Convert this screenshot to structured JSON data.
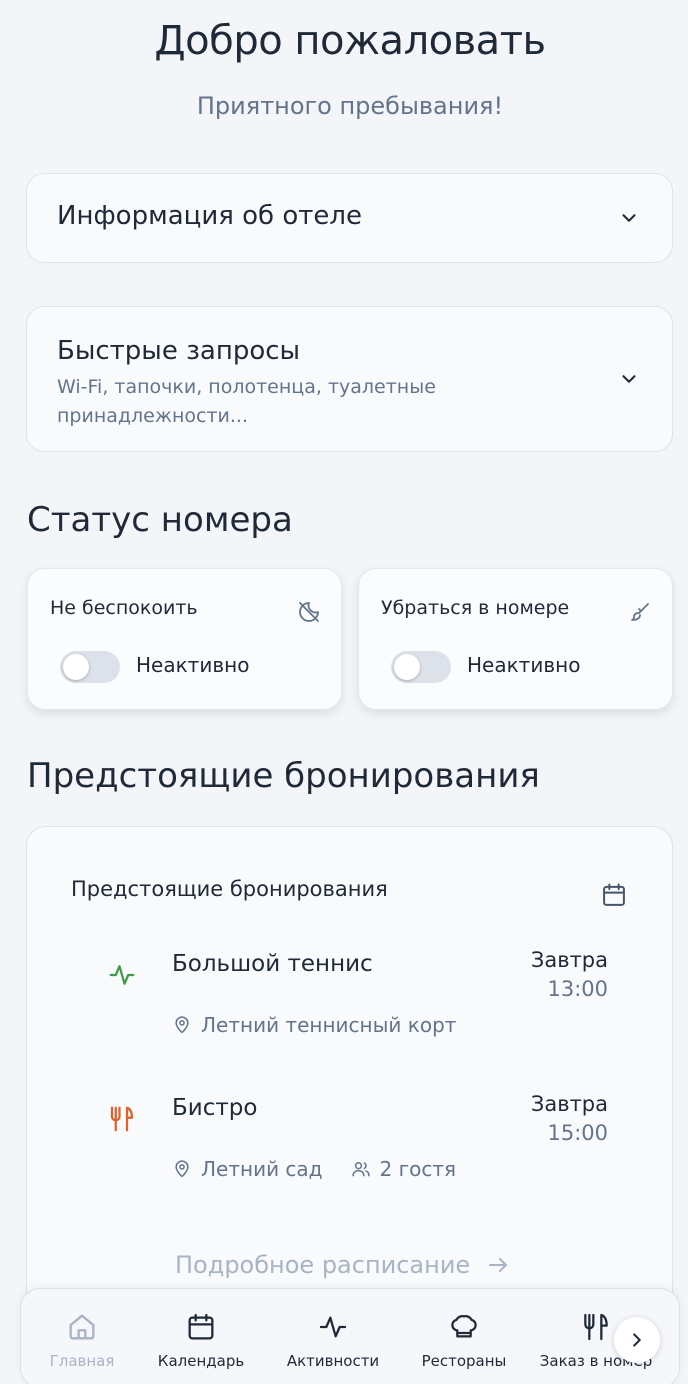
{
  "header": {
    "title": "Добро пожаловать",
    "subtitle": "Приятного пребывания!"
  },
  "accordions": [
    {
      "title": "Информация об отеле",
      "icon": "chevron-down-icon"
    },
    {
      "title": "Быстрые запросы",
      "subtitle": "Wi-Fi, тапочки, полотенца, туалетные принадлежности...",
      "icon": "chevron-down-icon"
    }
  ],
  "room_status": {
    "heading": "Статус номера",
    "cards": [
      {
        "title": "Не беспокоить",
        "icon": "do-not-disturb-icon",
        "state": "Неактивно",
        "enabled": false
      },
      {
        "title": "Убраться в номере",
        "icon": "brush-icon",
        "state": "Неактивно",
        "enabled": false
      }
    ]
  },
  "bookings": {
    "heading": "Предстоящие бронирования",
    "card_title": "Предстоящие бронирования",
    "card_icon": "calendar-icon",
    "items": [
      {
        "name": "Большой теннис",
        "icon": "activity-icon",
        "icon_color": "#3f9b4a",
        "day": "Завтра",
        "time": "13:00",
        "location": "Летний теннисный корт"
      },
      {
        "name": "Бистро",
        "icon": "utensils-icon",
        "icon_color": "#e0612b",
        "day": "Завтра",
        "time": "15:00",
        "location": "Летний сад",
        "guests": "2 гостя"
      }
    ],
    "link": "Подробное расписание"
  },
  "nav": {
    "items": [
      {
        "label": "Главная",
        "icon": "home-icon",
        "active": true
      },
      {
        "label": "Календарь",
        "icon": "calendar-icon",
        "active": false
      },
      {
        "label": "Активности",
        "icon": "activity-icon",
        "active": false
      },
      {
        "label": "Рестораны",
        "icon": "chef-hat-icon",
        "active": false
      },
      {
        "label": "Заказ в номер",
        "icon": "utensils-icon",
        "active": false
      }
    ],
    "next_icon": "chevron-right-icon"
  },
  "colors": {
    "background": "#f3f5f9",
    "text": "#1f2937",
    "muted": "#64748b",
    "inactive": "#a9b4c4",
    "activity_green": "#3f9b4a",
    "restaurant_orange": "#e0612b"
  }
}
